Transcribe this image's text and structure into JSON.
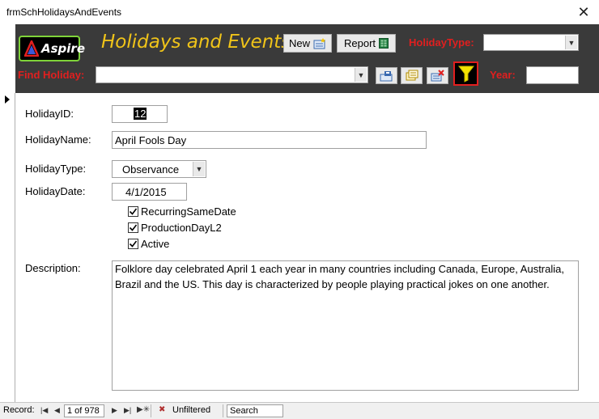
{
  "window": {
    "title": "frmSchHolidaysAndEvents"
  },
  "header": {
    "logo_text": "Aspire",
    "form_title": "Holidays and Events",
    "new_label": "New",
    "report_label": "Report",
    "holiday_type_label": "HolidayType:",
    "holiday_type_value": "",
    "find_holiday_label": "Find Holiday:",
    "find_holiday_value": "",
    "year_label": "Year:",
    "year_value": ""
  },
  "form": {
    "holiday_id_label": "HolidayID:",
    "holiday_id_value": "12",
    "holiday_name_label": "HolidayName:",
    "holiday_name_value": "April Fools Day",
    "holiday_type_label": "HolidayType:",
    "holiday_type_value": "Observance",
    "holiday_date_label": "HolidayDate:",
    "holiday_date_value": "4/1/2015",
    "recurring_label": "RecurringSameDate",
    "production_label": "ProductionDayL2",
    "active_label": "Active",
    "description_label": "Description:",
    "description_value": "Folklore day celebrated April 1 each year in many countries including Canada, Europe, Australia, Brazil and the US.  This day is characterized by people playing practical jokes on one another."
  },
  "navbar": {
    "record_label": "Record:",
    "record_value": "1 of 978",
    "filter_status": "Unfiltered",
    "search_label": "Search"
  },
  "colors": {
    "header_bg": "#3a3a3a",
    "title_gold": "#f0c419",
    "label_red": "#e11f1f",
    "logo_green": "#7fd33a",
    "filter_yellow": "#f5e400"
  }
}
